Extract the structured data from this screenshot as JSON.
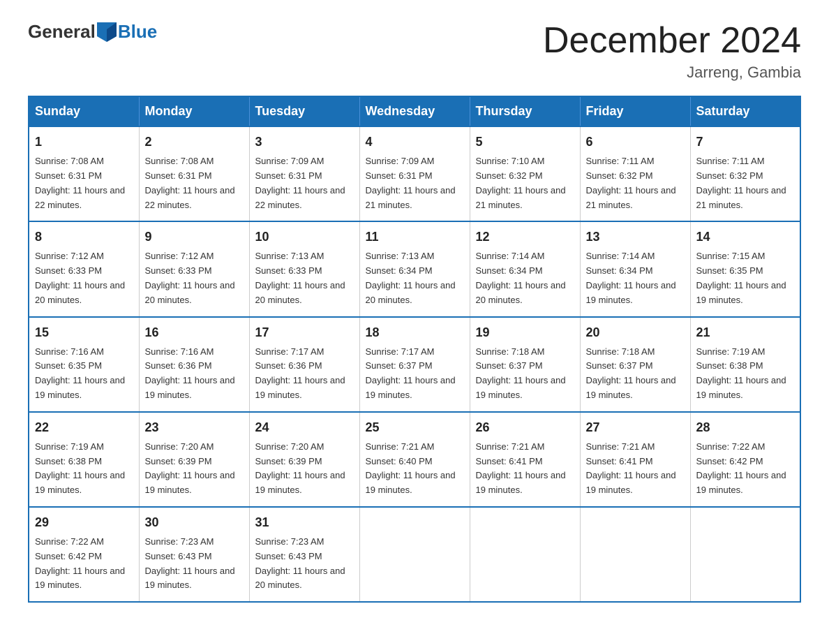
{
  "header": {
    "logo_general": "General",
    "logo_blue": "Blue",
    "month_title": "December 2024",
    "location": "Jarreng, Gambia"
  },
  "weekdays": [
    "Sunday",
    "Monday",
    "Tuesday",
    "Wednesday",
    "Thursday",
    "Friday",
    "Saturday"
  ],
  "weeks": [
    [
      {
        "day": "1",
        "sunrise": "7:08 AM",
        "sunset": "6:31 PM",
        "daylight": "11 hours and 22 minutes."
      },
      {
        "day": "2",
        "sunrise": "7:08 AM",
        "sunset": "6:31 PM",
        "daylight": "11 hours and 22 minutes."
      },
      {
        "day": "3",
        "sunrise": "7:09 AM",
        "sunset": "6:31 PM",
        "daylight": "11 hours and 22 minutes."
      },
      {
        "day": "4",
        "sunrise": "7:09 AM",
        "sunset": "6:31 PM",
        "daylight": "11 hours and 21 minutes."
      },
      {
        "day": "5",
        "sunrise": "7:10 AM",
        "sunset": "6:32 PM",
        "daylight": "11 hours and 21 minutes."
      },
      {
        "day": "6",
        "sunrise": "7:11 AM",
        "sunset": "6:32 PM",
        "daylight": "11 hours and 21 minutes."
      },
      {
        "day": "7",
        "sunrise": "7:11 AM",
        "sunset": "6:32 PM",
        "daylight": "11 hours and 21 minutes."
      }
    ],
    [
      {
        "day": "8",
        "sunrise": "7:12 AM",
        "sunset": "6:33 PM",
        "daylight": "11 hours and 20 minutes."
      },
      {
        "day": "9",
        "sunrise": "7:12 AM",
        "sunset": "6:33 PM",
        "daylight": "11 hours and 20 minutes."
      },
      {
        "day": "10",
        "sunrise": "7:13 AM",
        "sunset": "6:33 PM",
        "daylight": "11 hours and 20 minutes."
      },
      {
        "day": "11",
        "sunrise": "7:13 AM",
        "sunset": "6:34 PM",
        "daylight": "11 hours and 20 minutes."
      },
      {
        "day": "12",
        "sunrise": "7:14 AM",
        "sunset": "6:34 PM",
        "daylight": "11 hours and 20 minutes."
      },
      {
        "day": "13",
        "sunrise": "7:14 AM",
        "sunset": "6:34 PM",
        "daylight": "11 hours and 19 minutes."
      },
      {
        "day": "14",
        "sunrise": "7:15 AM",
        "sunset": "6:35 PM",
        "daylight": "11 hours and 19 minutes."
      }
    ],
    [
      {
        "day": "15",
        "sunrise": "7:16 AM",
        "sunset": "6:35 PM",
        "daylight": "11 hours and 19 minutes."
      },
      {
        "day": "16",
        "sunrise": "7:16 AM",
        "sunset": "6:36 PM",
        "daylight": "11 hours and 19 minutes."
      },
      {
        "day": "17",
        "sunrise": "7:17 AM",
        "sunset": "6:36 PM",
        "daylight": "11 hours and 19 minutes."
      },
      {
        "day": "18",
        "sunrise": "7:17 AM",
        "sunset": "6:37 PM",
        "daylight": "11 hours and 19 minutes."
      },
      {
        "day": "19",
        "sunrise": "7:18 AM",
        "sunset": "6:37 PM",
        "daylight": "11 hours and 19 minutes."
      },
      {
        "day": "20",
        "sunrise": "7:18 AM",
        "sunset": "6:37 PM",
        "daylight": "11 hours and 19 minutes."
      },
      {
        "day": "21",
        "sunrise": "7:19 AM",
        "sunset": "6:38 PM",
        "daylight": "11 hours and 19 minutes."
      }
    ],
    [
      {
        "day": "22",
        "sunrise": "7:19 AM",
        "sunset": "6:38 PM",
        "daylight": "11 hours and 19 minutes."
      },
      {
        "day": "23",
        "sunrise": "7:20 AM",
        "sunset": "6:39 PM",
        "daylight": "11 hours and 19 minutes."
      },
      {
        "day": "24",
        "sunrise": "7:20 AM",
        "sunset": "6:39 PM",
        "daylight": "11 hours and 19 minutes."
      },
      {
        "day": "25",
        "sunrise": "7:21 AM",
        "sunset": "6:40 PM",
        "daylight": "11 hours and 19 minutes."
      },
      {
        "day": "26",
        "sunrise": "7:21 AM",
        "sunset": "6:41 PM",
        "daylight": "11 hours and 19 minutes."
      },
      {
        "day": "27",
        "sunrise": "7:21 AM",
        "sunset": "6:41 PM",
        "daylight": "11 hours and 19 minutes."
      },
      {
        "day": "28",
        "sunrise": "7:22 AM",
        "sunset": "6:42 PM",
        "daylight": "11 hours and 19 minutes."
      }
    ],
    [
      {
        "day": "29",
        "sunrise": "7:22 AM",
        "sunset": "6:42 PM",
        "daylight": "11 hours and 19 minutes."
      },
      {
        "day": "30",
        "sunrise": "7:23 AM",
        "sunset": "6:43 PM",
        "daylight": "11 hours and 19 minutes."
      },
      {
        "day": "31",
        "sunrise": "7:23 AM",
        "sunset": "6:43 PM",
        "daylight": "11 hours and 20 minutes."
      },
      null,
      null,
      null,
      null
    ]
  ]
}
